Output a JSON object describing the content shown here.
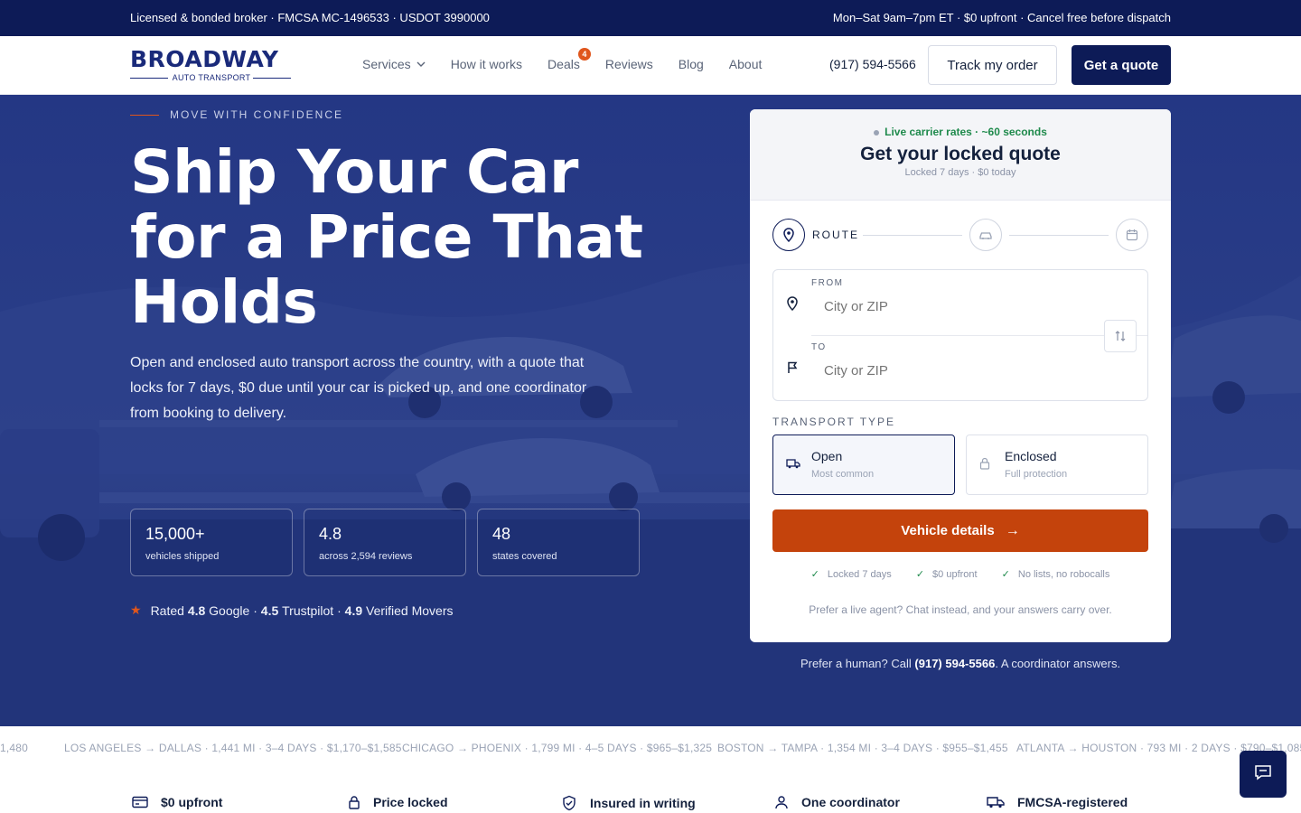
{
  "topbar": {
    "left": "Licensed & bonded broker · FMCSA MC-1496533 · USDOT 3990000",
    "right": "Mon–Sat 9am–7pm ET · $0 upfront · Cancel free before dispatch"
  },
  "brand": {
    "name": "BROADWAY",
    "tagline": "AUTO TRANSPORT",
    "color": "#1a2a7a"
  },
  "nav": {
    "items": [
      {
        "label": "Services",
        "icon": "chevron-down-icon"
      },
      {
        "label": "How it works"
      },
      {
        "label": "Deals",
        "badge": "4"
      },
      {
        "label": "Reviews"
      },
      {
        "label": "Blog"
      },
      {
        "label": "About"
      }
    ],
    "phone": "(917) 594-5566",
    "track_label": "Track my order",
    "quote_label": "Get a quote"
  },
  "hero": {
    "eyebrow": "MOVE WITH CONFIDENCE",
    "headline": "Ship Your Car for a Price That Holds",
    "lead": "Open and enclosed auto transport across the country, with a quote that locks for 7 days, $0 due until your car is picked up, and one coordinator from booking to delivery.",
    "stats": [
      {
        "value": "15,000+",
        "label": "vehicles shipped"
      },
      {
        "value": "4.8",
        "label": "across 2,594 reviews"
      },
      {
        "value": "48",
        "label": "states covered"
      }
    ],
    "rated": {
      "prefix": "Rated",
      "google_score": "4.8",
      "google": "Google",
      "sep1": "·",
      "trustpilot_score": "4.5",
      "trustpilot": "Trustpilot",
      "sep2": "·",
      "verified_score": "4.9",
      "verified": "Verified Movers"
    },
    "human": {
      "prefix": "Prefer a human? Call",
      "phone": "(917) 594-5566",
      "suffix": ". A coordinator answers."
    }
  },
  "quote_card": {
    "live": "Live carrier rates · ~60 seconds",
    "title": "Get your locked quote",
    "subtitle": "Locked 7 days · $0 today",
    "step_label": "ROUTE",
    "from_label": "FROM",
    "from_placeholder": "City or ZIP",
    "to_label": "TO",
    "to_placeholder": "City or ZIP",
    "transport_label": "TRANSPORT TYPE",
    "options": [
      {
        "title": "Open",
        "sub": "Most common",
        "selected": true
      },
      {
        "title": "Enclosed",
        "sub": "Full protection",
        "selected": false
      }
    ],
    "cta": "Vehicle details",
    "checks": [
      "Locked 7 days",
      "$0 upfront",
      "No lists, no robocalls"
    ],
    "prefer": "Prefer a live agent? Chat instead, and your answers carry over."
  },
  "ticker": [
    "1,480",
    "LOS ANGELES → DALLAS · 1,441 MI · 3–4 DAYS · $1,170–$1,585",
    "CHICAGO → PHOENIX · 1,799 MI · 4–5 DAYS · $965–$1,325",
    "BOSTON → TAMPA · 1,354 MI · 3–4 DAYS · $955–$1,455",
    "ATLANTA → HOUSTON · 793 MI · 2 DAYS · $790–$1,085"
  ],
  "features": [
    {
      "label": "$0 upfront",
      "icon": "credit-card-icon"
    },
    {
      "label": "Price locked",
      "icon": "lock-icon"
    },
    {
      "label": "Insured in writing",
      "icon": "shield-check-icon"
    },
    {
      "label": "One coordinator",
      "icon": "user-icon"
    },
    {
      "label": "FMCSA-registered",
      "icon": "truck-icon"
    }
  ],
  "colors": {
    "navy": "#0d1b57",
    "hero": "#273a84",
    "accent": "#e0561c",
    "cta": "#c4430c",
    "success": "#1f8a4c"
  }
}
